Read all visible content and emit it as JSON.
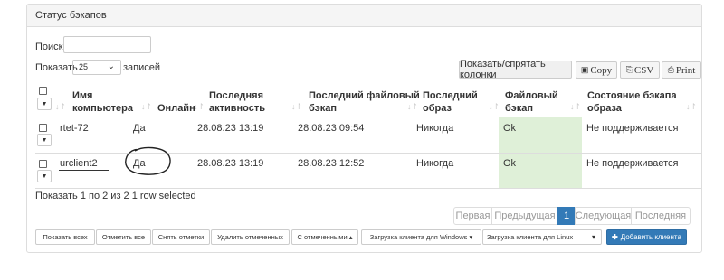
{
  "panel": {
    "title": "Статус бэкапов"
  },
  "search": {
    "label": "Поиск:",
    "value": ""
  },
  "length": {
    "prefix": "Показать",
    "selected": "25",
    "suffix": "записей"
  },
  "toolbar": {
    "columns_label": "Показать/спрятать колонки",
    "copy_label": "Copy",
    "csv_label": "CSV",
    "print_label": "Print"
  },
  "columns": [
    {
      "line1": "Имя",
      "line2": "компьютера"
    },
    {
      "line1": "",
      "line2": "Онлайн"
    },
    {
      "line1": "Последняя",
      "line2": "активность"
    },
    {
      "line1": "Последний файловый",
      "line2": "бэкап"
    },
    {
      "line1": "Последний",
      "line2": "образ"
    },
    {
      "line1": "Файловый",
      "line2": "бэкап"
    },
    {
      "line1": "Состояние бэкапа",
      "line2": "образа"
    }
  ],
  "rows": [
    {
      "name": "rtet-72",
      "online": "Да",
      "last_activity": "28.08.23 13:19",
      "last_file_backup": "28.08.23 09:54",
      "last_image": "Никогда",
      "file_backup": "Ok",
      "image_state": "Не поддерживается"
    },
    {
      "name": "urclient2",
      "online": "Да",
      "last_activity": "28.08.23 13:19",
      "last_file_backup": "28.08.23 12:52",
      "last_image": "Никогда",
      "file_backup": "Ok",
      "image_state": "Не поддерживается"
    }
  ],
  "info": "Показать 1 по 2 из 2 1 row selected",
  "pagination": {
    "first": "Первая",
    "prev": "Предыдущая",
    "current": "1",
    "next": "Следующая",
    "last": "Последняя"
  },
  "actions": {
    "show_all": "Показать всех",
    "select_all": "Отметить все",
    "unselect": "Снять отметки",
    "delete_selected": "Удалить отмеченных",
    "with_selected": "С отмеченными ▴",
    "download_windows": "Загрузка клиента для Windows ▾",
    "download_linux": "Загрузка клиента для Linux",
    "add_client": "Добавить клиента"
  },
  "colors": {
    "primary": "#337ab7",
    "ok_cell": "#dff0d8"
  }
}
